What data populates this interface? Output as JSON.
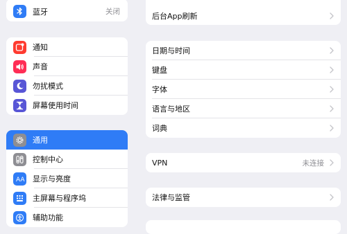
{
  "sidebar": {
    "group1": {
      "bluetooth": {
        "label": "蓝牙",
        "value": "关闭",
        "icon": "bluetooth-icon",
        "color": "#2f7cf6"
      }
    },
    "group2": {
      "notifications": {
        "label": "通知",
        "icon": "notifications-icon",
        "color": "#ff3b30"
      },
      "sounds": {
        "label": "声音",
        "icon": "sound-icon",
        "color": "#ff2d55"
      },
      "focus": {
        "label": "勿扰模式",
        "icon": "moon-icon",
        "color": "#5856d6"
      },
      "screentime": {
        "label": "屏幕使用时间",
        "icon": "hourglass-icon",
        "color": "#5856d6"
      }
    },
    "group3": {
      "general": {
        "label": "通用",
        "icon": "gear-icon",
        "color": "#8e8e93",
        "selected": true
      },
      "control_center": {
        "label": "控制中心",
        "icon": "control-center-icon",
        "color": "#8e8e93"
      },
      "display": {
        "label": "显示与亮度",
        "icon": "display-brightness-icon",
        "color": "#2f7cf6"
      },
      "home_screen": {
        "label": "主屏幕与程序坞",
        "icon": "home-screen-icon",
        "color": "#2f7cf6"
      },
      "accessibility": {
        "label": "辅助功能",
        "icon": "accessibility-icon",
        "color": "#2f7cf6"
      }
    }
  },
  "main": {
    "group1": {
      "background_refresh": {
        "label": "后台App刷新"
      }
    },
    "group2": {
      "date_time": {
        "label": "日期与时间"
      },
      "keyboard": {
        "label": "键盘"
      },
      "fonts": {
        "label": "字体"
      },
      "language_region": {
        "label": "语言与地区"
      },
      "dictionary": {
        "label": "词典"
      }
    },
    "group3": {
      "vpn": {
        "label": "VPN",
        "value": "未连接"
      }
    },
    "group4": {
      "legal": {
        "label": "法律与监管"
      }
    }
  }
}
